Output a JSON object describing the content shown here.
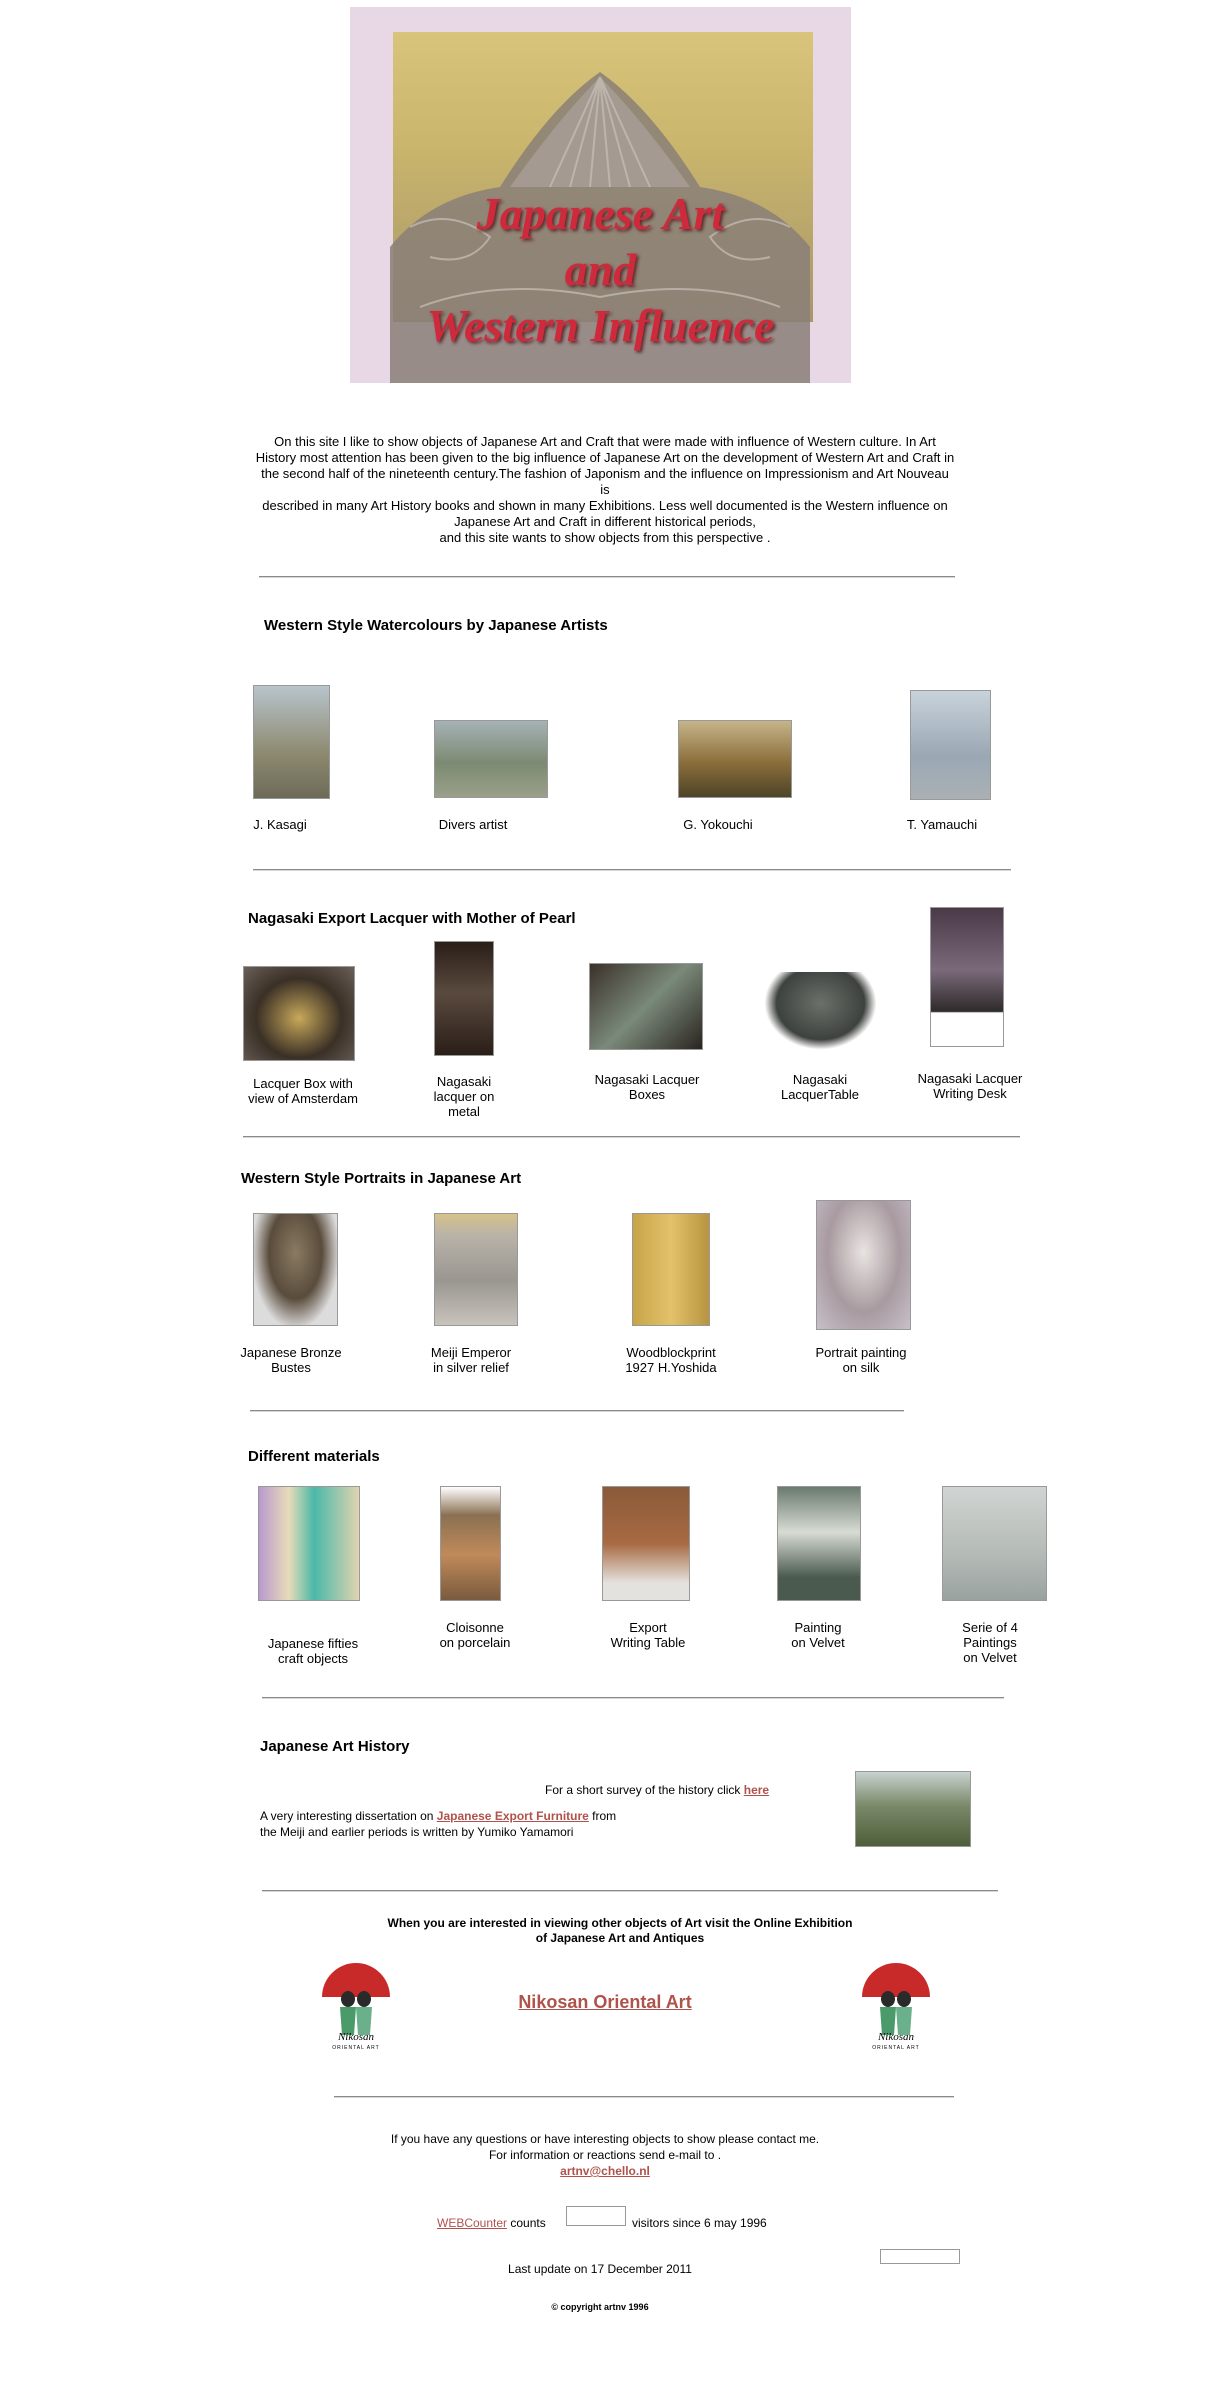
{
  "banner": {
    "line1": "Japanese Art",
    "line2": "and",
    "line3": "Western Influence"
  },
  "intro": {
    "lines": [
      "On this site I like to show objects of Japanese Art and Craft that were made with influence of Western culture. In Art",
      "History most attention has been given to the big influence of Japanese Art on the development of Western Art and Craft in",
      "the second half of the nineteenth century.The fashion of Japonism and the influence on Impressionism and Art Nouveau is",
      "described in many Art History books and shown in many Exhibitions. Less well documented is the Western influence on",
      "Japanese Art and Craft in different historical periods,",
      "and this site wants to show objects from this perspective ."
    ]
  },
  "sections": {
    "watercolours": {
      "title": "Western Style Watercolours by Japanese Artists",
      "items": [
        "J. Kasagi",
        "Divers artist",
        "G. Yokouchi",
        "T. Yamauchi"
      ]
    },
    "lacquer": {
      "title": "Nagasaki Export Lacquer with Mother of Pearl",
      "items": [
        [
          "Lacquer Box with",
          "view of Amsterdam"
        ],
        [
          "Nagasaki",
          "lacquer on",
          "metal"
        ],
        [
          "Nagasaki Lacquer",
          "Boxes"
        ],
        [
          "Nagasaki",
          "LacquerTable"
        ],
        [
          "Nagasaki Lacquer",
          "Writing Desk"
        ]
      ]
    },
    "portraits": {
      "title": "Western Style Portraits in Japanese Art",
      "items": [
        [
          "Japanese Bronze",
          "Bustes"
        ],
        [
          "Meiji Emperor",
          "in silver relief"
        ],
        [
          "Woodblockprint",
          "1927 H.Yoshida"
        ],
        [
          "Portrait painting",
          "on silk"
        ]
      ]
    },
    "materials": {
      "title": "Different materials",
      "items": [
        [
          "Japanese fifties",
          "craft objects"
        ],
        [
          "Cloisonne",
          "on porcelain"
        ],
        [
          "Export",
          "Writing Table"
        ],
        [
          "Painting",
          "on Velvet"
        ],
        [
          "Serie of 4",
          "Paintings",
          "on Velvet"
        ]
      ]
    },
    "history": {
      "title": "Japanese Art History",
      "survey_text": "For a short survey of the history click",
      "survey_link": "here",
      "diss_prefix": "A very interesting dissertation on",
      "diss_link": "Japanese Export Furniture",
      "diss_suffix": "from",
      "diss_line2": "the Meiji and earlier periods is written by Yumiko Yamamori"
    }
  },
  "exhibition": {
    "line1": "When you are interested in viewing other objects of Art visit the Online Exhibition",
    "line2": "of Japanese Art and Antiques",
    "link": "Nikosan Oriental Art",
    "logo_text": "Nikosan",
    "logo_sub": "ORIENTAL ART"
  },
  "contact": {
    "line1": "If you have any questions or have interesting objects to show please contact me.",
    "line2": "For information or reactions send e-mail to .",
    "email": "artnv@chello.nl"
  },
  "counter": {
    "link": "WEBCounter",
    "counts": "counts",
    "since": "visitors since 6 may 1996"
  },
  "last_update": "Last update on 17 December 2011",
  "copyright": "© copyright artnv 1996",
  "colors": {
    "link": "#b0524c",
    "banner_title": "#cf2a3c"
  }
}
